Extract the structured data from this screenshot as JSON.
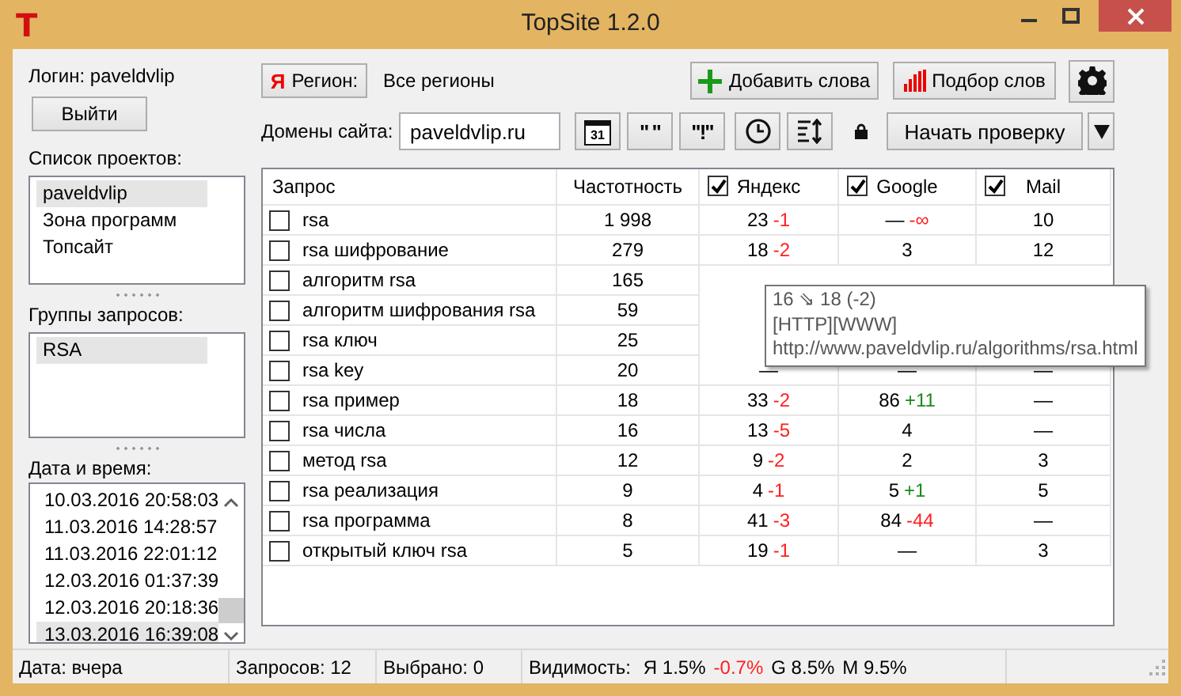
{
  "window": {
    "logo": "T",
    "title": "TopSite 1.2.0"
  },
  "sidebar": {
    "login": "Логин: paveldvlip",
    "logout_button": "Выйти",
    "projects_label": "Список проектов:",
    "projects": [
      {
        "label": "paveldvlip",
        "selected": true
      },
      {
        "label": "Зона программ",
        "selected": false
      },
      {
        "label": "Топсайт",
        "selected": false
      }
    ],
    "groups_label": "Группы запросов:",
    "groups": [
      {
        "label": "RSA",
        "selected": true
      }
    ],
    "dates_label": "Дата и время:",
    "dates": [
      {
        "label": "10.03.2016 20:58:03",
        "selected": false
      },
      {
        "label": "11.03.2016 14:28:57",
        "selected": false
      },
      {
        "label": "11.03.2016 22:01:12",
        "selected": false
      },
      {
        "label": "12.03.2016 01:37:39",
        "selected": false
      },
      {
        "label": "12.03.2016 20:18:36",
        "selected": false
      },
      {
        "label": "13.03.2016 16:39:08",
        "selected": true
      }
    ]
  },
  "toolbar": {
    "region_icon": "Я",
    "region_button": "Регион:",
    "region_value": "Все регионы",
    "add_button": "Добавить слова",
    "pick_button": "Подбор слов",
    "domains_label": "Домены сайта:",
    "domain_value": "paveldvlip.ru",
    "calendar_day": "31",
    "quote_button": "\" \"",
    "exact_button": "\"!\"",
    "start_button": "Начать проверку"
  },
  "table": {
    "columns": [
      {
        "label": "Запрос"
      },
      {
        "label": "Частотность"
      },
      {
        "label": "Яндекс",
        "checked": true
      },
      {
        "label": "Google",
        "checked": true
      },
      {
        "label": "Mail",
        "checked": true
      }
    ],
    "rows": [
      {
        "query": "rsa",
        "checked": false,
        "frequency": "1 998",
        "yandex": {
          "value": "23",
          "delta": "-1",
          "color": "#ff1e1e"
        },
        "google": {
          "value": "—",
          "delta": "-∞",
          "color": "#ff1e1e"
        },
        "mail": {
          "value": "10"
        }
      },
      {
        "query": "rsa шифрование",
        "checked": false,
        "frequency": "279",
        "yandex": {
          "value": "18",
          "delta": "-2",
          "color": "#ff1e1e"
        },
        "google": {
          "value": "3"
        },
        "mail": {
          "value": "12"
        }
      },
      {
        "query": "алгоритм rsa",
        "checked": false,
        "frequency": "165"
      },
      {
        "query": "алгоритм шифрования rsa",
        "checked": false,
        "frequency": "59"
      },
      {
        "query": "rsa ключ",
        "checked": false,
        "frequency": "25"
      },
      {
        "query": "rsa key",
        "checked": false,
        "frequency": "20",
        "yandex": {
          "value": "—"
        },
        "google": {
          "value": "—"
        },
        "mail": {
          "value": "—"
        }
      },
      {
        "query": "rsa пример",
        "checked": false,
        "frequency": "18",
        "yandex": {
          "value": "33",
          "delta": "-2",
          "color": "#ff1e1e"
        },
        "google": {
          "value": "86",
          "delta": "+11",
          "color": "#1a8a1a"
        },
        "mail": {
          "value": "—"
        }
      },
      {
        "query": "rsa числа",
        "checked": false,
        "frequency": "16",
        "yandex": {
          "value": "13",
          "delta": "-5",
          "color": "#ff1e1e"
        },
        "google": {
          "value": "4"
        },
        "mail": {
          "value": "—"
        }
      },
      {
        "query": "метод rsa",
        "checked": false,
        "frequency": "12",
        "yandex": {
          "value": "9",
          "delta": "-2",
          "color": "#ff1e1e"
        },
        "google": {
          "value": "2"
        },
        "mail": {
          "value": "3"
        }
      },
      {
        "query": "rsa реализация",
        "checked": false,
        "frequency": "9",
        "yandex": {
          "value": "4",
          "delta": "-1",
          "color": "#ff1e1e"
        },
        "google": {
          "value": "5",
          "delta": "+1",
          "color": "#1a8a1a"
        },
        "mail": {
          "value": "5"
        }
      },
      {
        "query": "rsa программа",
        "checked": false,
        "frequency": "8",
        "yandex": {
          "value": "41",
          "delta": "-3",
          "color": "#ff1e1e"
        },
        "google": {
          "value": "84",
          "delta": "-44",
          "color": "#ff1e1e"
        },
        "mail": {
          "value": "—"
        }
      },
      {
        "query": "открытый ключ rsa",
        "checked": false,
        "frequency": "5",
        "yandex": {
          "value": "19",
          "delta": "-1",
          "color": "#ff1e1e"
        },
        "google": {
          "value": "—"
        },
        "mail": {
          "value": "3"
        }
      }
    ]
  },
  "tooltip": {
    "lines": [
      "16 ⇘ 18 (-2)",
      "[HTTP][WWW]",
      "http://www.paveldvlip.ru/algorithms/rsa.html"
    ]
  },
  "status_bar": {
    "date": "Дата: вчера",
    "queries": "Запросов: 12",
    "selected": "Выбрано: 0",
    "visibility_label": "Видимость:",
    "visibility": [
      {
        "text": "Я 1.5%"
      },
      {
        "text": "-0.7%",
        "color": "#ff1e1e"
      },
      {
        "text": "G 8.5%"
      },
      {
        "text": "M 9.5%"
      }
    ]
  }
}
